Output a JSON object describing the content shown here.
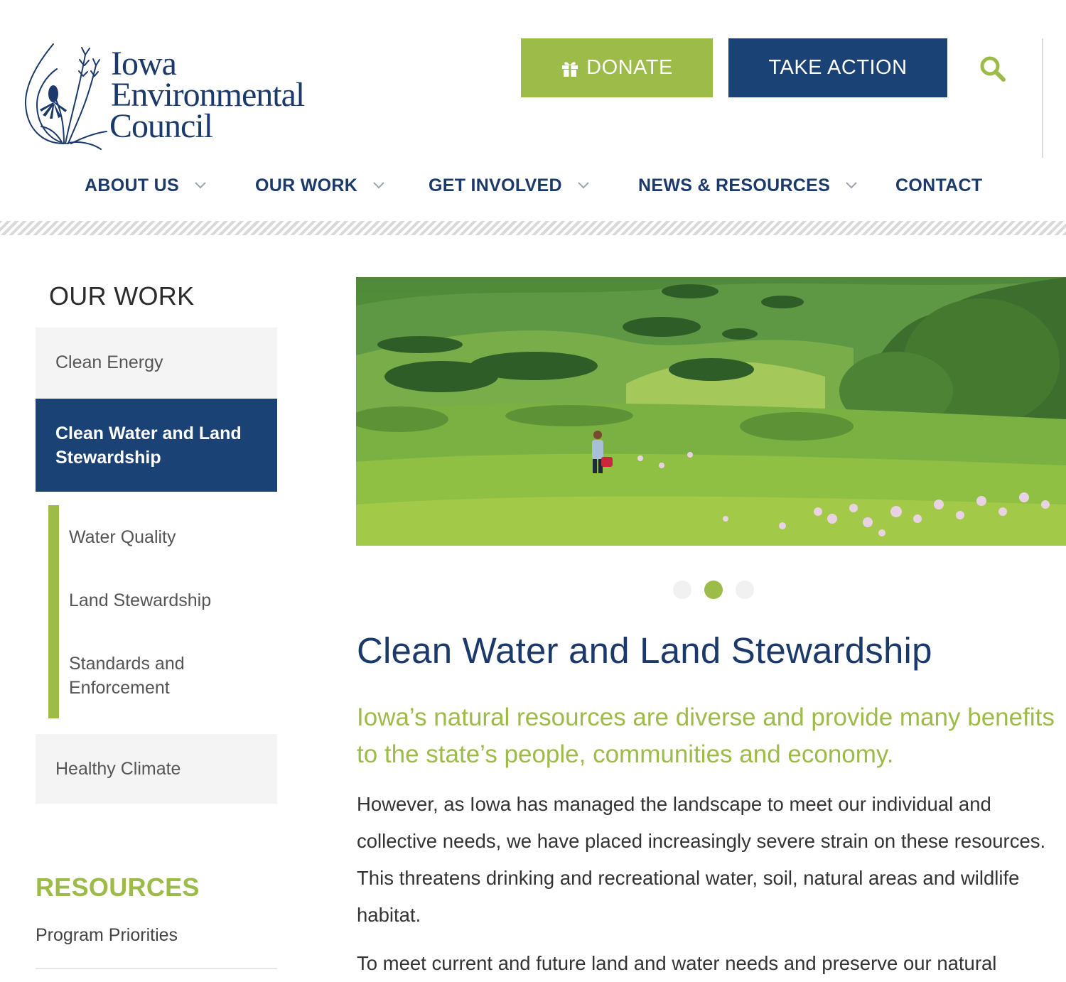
{
  "header": {
    "logo": {
      "line1": "Iowa",
      "line2": "Environmental",
      "line3": "Council"
    },
    "donate_label": "DONATE",
    "take_action_label": "TAKE ACTION",
    "search_icon": "search-icon",
    "gift_icon": "gift-icon"
  },
  "nav": {
    "items": [
      {
        "label": "ABOUT US",
        "has_dropdown": true
      },
      {
        "label": "OUR WORK",
        "has_dropdown": true
      },
      {
        "label": "GET INVOLVED",
        "has_dropdown": true
      },
      {
        "label": "NEWS & RESOURCES",
        "has_dropdown": true
      },
      {
        "label": "CONTACT",
        "has_dropdown": false
      }
    ]
  },
  "sidebar": {
    "heading": "OUR WORK",
    "items": [
      {
        "label": "Clean Energy",
        "active": false
      },
      {
        "label": "Clean Water and Land Stewardship",
        "active": true
      },
      {
        "label": "Healthy Climate",
        "active": false
      }
    ],
    "subitems": [
      {
        "label": "Water Quality"
      },
      {
        "label": "Land Stewardship"
      },
      {
        "label": "Standards and Enforcement"
      }
    ],
    "resources_heading": "RESOURCES",
    "resources": [
      {
        "label": "Program Priorities"
      }
    ]
  },
  "hero": {
    "slides": 3,
    "active_slide": 2
  },
  "content": {
    "title": "Clean Water and Land Stewardship",
    "lead": "Iowa’s natural resources are diverse and provide many benefits to the state’s people, communities and economy.",
    "paragraph1": "However, as Iowa has managed the landscape to meet our individual and collective needs, we have placed increasingly severe strain on these resources. This threatens drinking and recreational water, soil, natural areas and wildlife habitat.",
    "paragraph2": "To meet current and future land and water needs and preserve our natural"
  },
  "colors": {
    "navy": "#1b4275",
    "green": "#9dbb48",
    "text": "#333333"
  }
}
